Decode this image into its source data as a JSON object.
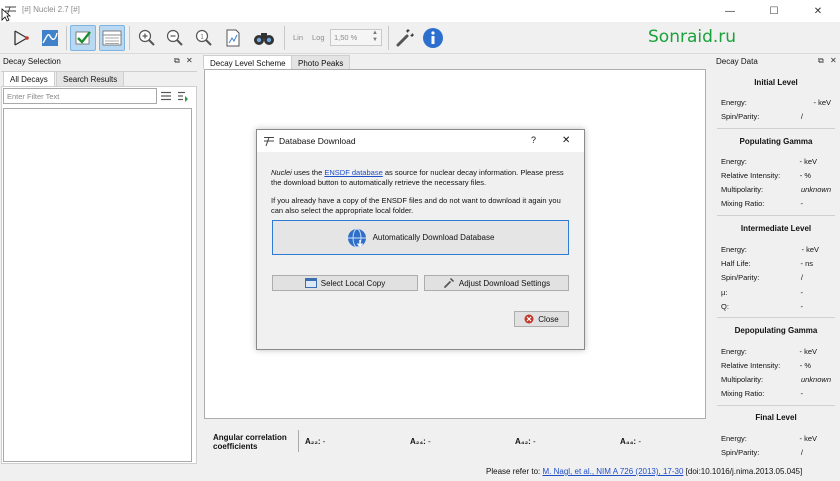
{
  "window": {
    "title": "[#] Nuclei 2.7 [#]",
    "controls": [
      "—",
      "☐",
      "✕"
    ]
  },
  "toolbar": {
    "lin_label": "Lin",
    "log_label": "Log",
    "zoom_value": "1,50 %",
    "watermark": "Sonraid.ru"
  },
  "left_panel": {
    "title": "Decay Selection",
    "tabs": [
      "All Decays",
      "Search Results"
    ],
    "filter_placeholder": "Enter Filter Text"
  },
  "center": {
    "tabs": [
      "Decay Level Scheme",
      "Photo Peaks"
    ],
    "angular": {
      "label_line1": "Angular correlation",
      "label_line2": "coefficients",
      "coeffs": [
        {
          "name": "A₂₂:",
          "value": "-"
        },
        {
          "name": "A₂₄:",
          "value": "-"
        },
        {
          "name": "A₄₂:",
          "value": "-"
        },
        {
          "name": "A₄₄:",
          "value": "-"
        }
      ]
    }
  },
  "right_panel": {
    "title": "Decay Data",
    "sections": [
      {
        "heading": "Initial Level",
        "rows": [
          {
            "label": "Energy:",
            "value": "- keV"
          },
          {
            "label": "Spin/Parity:",
            "value": "/"
          }
        ]
      },
      {
        "heading": "Populating Gamma",
        "rows": [
          {
            "label": "Energy:",
            "value": "- keV"
          },
          {
            "label": "Relative Intensity:",
            "value": "- %"
          },
          {
            "label": "Multipolarity:",
            "value": "unknown"
          },
          {
            "label": "Mixing Ratio:",
            "value": "-"
          }
        ]
      },
      {
        "heading": "Intermediate Level",
        "rows": [
          {
            "label": "Energy:",
            "value": "- keV"
          },
          {
            "label": "Half Life:",
            "value": "- ns"
          },
          {
            "label": "Spin/Parity:",
            "value": "/"
          },
          {
            "label": "µ:",
            "value": "-"
          },
          {
            "label": "Q:",
            "value": "-"
          }
        ]
      },
      {
        "heading": "Depopulating Gamma",
        "rows": [
          {
            "label": "Energy:",
            "value": "- keV"
          },
          {
            "label": "Relative Intensity:",
            "value": "- %"
          },
          {
            "label": "Multipolarity:",
            "value": "unknown"
          },
          {
            "label": "Mixing Ratio:",
            "value": "-"
          }
        ]
      },
      {
        "heading": "Final Level",
        "rows": [
          {
            "label": "Energy:",
            "value": "- keV"
          },
          {
            "label": "Spin/Parity:",
            "value": "/"
          }
        ]
      }
    ]
  },
  "dialog": {
    "title": "Database Download",
    "help": "?",
    "close": "✕",
    "para1_app": "Nuclei",
    "para1_a": " uses the ",
    "para1_link": "ENSDF database",
    "para1_b": " as source for nuclear decay information. Please press the download button to automatically retrieve the necessary files.",
    "para2": "If you already have a copy of the ENSDF files and do not want to download it again you can also select the appropriate local folder.",
    "auto_download_label": "Automatically Download Database",
    "select_local_label": "Select Local Copy",
    "adjust_settings_label": "Adjust Download Settings",
    "close_label": "Close"
  },
  "status": {
    "prefix": "Please refer to:",
    "citation_link": "M. Nagl, et al., NIM A 726 (2013), 17-30",
    "doi": "[doi:10.1016/j.nima.2013.05.045]"
  }
}
